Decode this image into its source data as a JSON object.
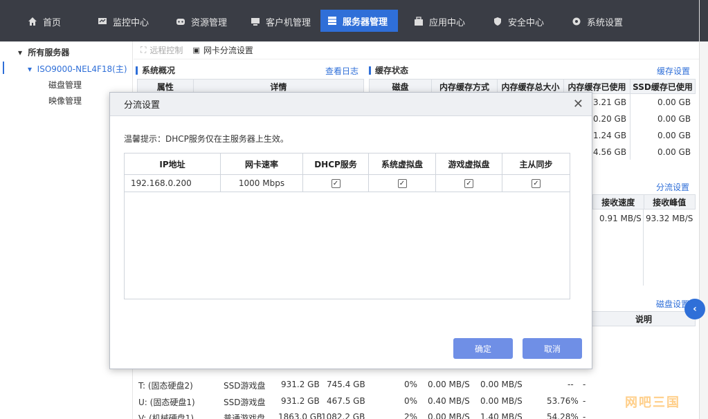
{
  "nav": {
    "items": [
      {
        "label": "首页",
        "icon": "home-icon"
      },
      {
        "label": "监控中心",
        "icon": "monitor-icon"
      },
      {
        "label": "资源管理",
        "icon": "resource-icon"
      },
      {
        "label": "客户机管理",
        "icon": "client-icon"
      },
      {
        "label": "服务器管理",
        "icon": "server-icon"
      },
      {
        "label": "应用中心",
        "icon": "app-icon"
      },
      {
        "label": "安全中心",
        "icon": "shield-icon"
      },
      {
        "label": "系统设置",
        "icon": "gear-icon"
      }
    ],
    "active_index": 4
  },
  "tree": {
    "root": "所有服务器",
    "server": "ISO9000-NEL4F18(主)",
    "children": [
      "磁盘管理",
      "映像管理"
    ]
  },
  "toolbar": {
    "remote_control": "远程控制",
    "nic_split": "网卡分流设置"
  },
  "system_overview": {
    "title": "系统概况",
    "link": "查看日志",
    "headers": [
      "属性",
      "详情"
    ]
  },
  "cache_status": {
    "title": "缓存状态",
    "link": "缓存设置",
    "headers": [
      "磁盘",
      "内存缓存方式",
      "内存缓存总大小",
      "内存缓存已使用",
      "SSD缓存已使用"
    ],
    "mem_used": [
      "3.21 GB",
      "0.20 GB",
      "1.24 GB",
      "4.56 GB"
    ],
    "ssd_used": [
      "0.00 GB",
      "0.00 GB",
      "0.00 GB",
      "0.00 GB"
    ]
  },
  "split": {
    "link": "分流设置",
    "headers": [
      "接收速度",
      "接收峰值"
    ],
    "row": [
      "0.91 MB/S",
      "93.32 MB/S"
    ]
  },
  "disk": {
    "link": "磁盘设置",
    "desc_header": "说明",
    "rows": [
      [
        "T: (固态硬盘2)",
        "SSD游戏盘",
        "931.2 GB",
        "745.4 GB",
        "0%",
        "0.00 MB/S",
        "0.00 MB/S",
        "--",
        "-"
      ],
      [
        "U: (固态硬盘1)",
        "SSD游戏盘",
        "931.2 GB",
        "467.5 GB",
        "0%",
        "0.40 MB/S",
        "0.00 MB/S",
        "53.76%",
        "-"
      ],
      [
        "V: (机械硬盘1)",
        "普通游戏盘",
        "1863.0 GB",
        "1082.2 GB",
        "2%",
        "0.00 MB/S",
        "1.40 MB/S",
        "54.28%",
        "-"
      ]
    ]
  },
  "dialog": {
    "title": "分流设置",
    "hint": "温馨提示：DHCP服务仅在主服务器上生效。",
    "headers": [
      "IP地址",
      "网卡速率",
      "DHCP服务",
      "系统虚拟盘",
      "游戏虚拟盘",
      "主从同步"
    ],
    "row": {
      "ip": "192.168.0.200",
      "speed": "1000 Mbps",
      "checks": [
        true,
        true,
        true,
        true
      ]
    },
    "ok": "确定",
    "cancel": "取消"
  },
  "watermark": "网吧三国",
  "colors": {
    "nav_bg": "#3a3d45",
    "accent": "#2f6fd8",
    "button": "#6f8fe6"
  }
}
